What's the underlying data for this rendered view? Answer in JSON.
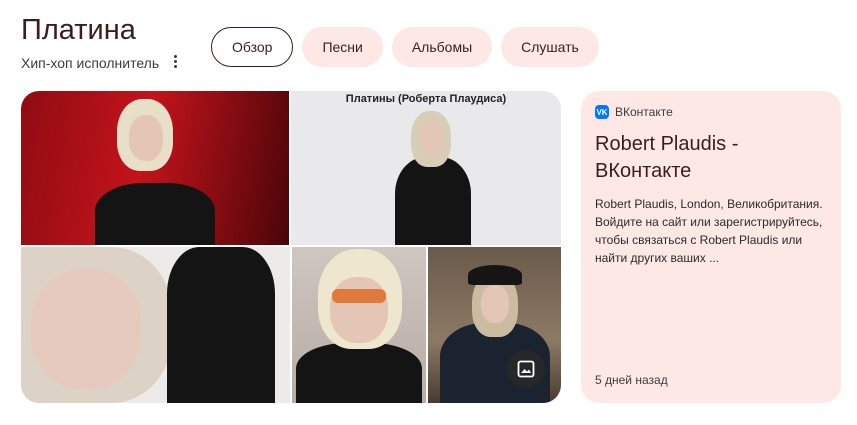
{
  "header": {
    "title": "Платина",
    "subtitle": "Хип-хоп исполнитель"
  },
  "tabs": [
    {
      "label": "Обзор",
      "active": true
    },
    {
      "label": "Песни",
      "active": false
    },
    {
      "label": "Альбомы",
      "active": false
    },
    {
      "label": "Слушать",
      "active": false
    }
  ],
  "gallery": {
    "caption": "Платины (Роберта Плаудиса)"
  },
  "card": {
    "source": "ВКонтакте",
    "title": "Robert Plaudis - ВКонтакте",
    "description": "Robert Plaudis, London, Великобритания. Войдите на сайт или зарегистрируйтесь, чтобы связаться с Robert Plaudis или найти других ваших ...",
    "time": "5 дней назад"
  },
  "colors": {
    "accent": "#3c1d1d",
    "chip_bg": "#fde8e6",
    "vk_blue": "#0077ff"
  }
}
